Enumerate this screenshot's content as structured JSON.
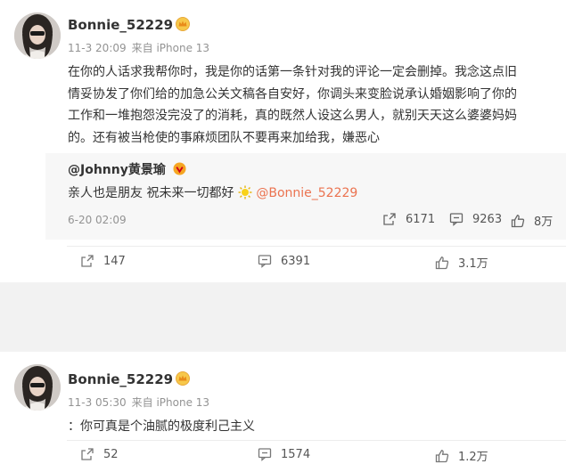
{
  "post1": {
    "username": "Bonnie_52229",
    "time": "11-3 20:09",
    "source": "来自 iPhone 13",
    "content_lines": [
      "在你的人话求我帮你时，我是你的话第一条针对我的评论一定会删掉。我念这点旧",
      "情妥协发了你们给的加急公关文稿各自安好，你调头来变脸说承认婚姻影响了你的",
      "工作和一堆抱怨没完没了的消耗，真的既然人设这么男人，就别天天这么婆婆妈妈",
      "的。还有被当枪使的事麻烦团队不要再来加给我，嫌恶心"
    ],
    "repost": {
      "user": "@Johnny黄景瑜",
      "text": "亲人也是朋友 祝未来一切都好",
      "mention": "@Bonnie_52229",
      "time": "6-20 02:09",
      "forward_count": "6171",
      "comment_count": "9263",
      "like_count": "8万"
    },
    "forward_count": "147",
    "comment_count": "6391",
    "like_count": "3.1万"
  },
  "post2": {
    "username": "Bonnie_52229",
    "time": "11-3 05:30",
    "source": "来自 iPhone 13",
    "content": "：你可真是个油腻的极度利己主义",
    "forward_count": "52",
    "comment_count": "1574",
    "like_count": "1.2万"
  },
  "icons": {
    "forward": "forward-icon",
    "comment": "comment-icon",
    "like": "like-icon",
    "vip_badge": "crown-badge-icon",
    "verified_badge": "verified-badge-icon",
    "emoji": "sun-emoji-icon"
  },
  "colors": {
    "mention": "#eb7350",
    "meta": "#939393",
    "divider": "#f2f2f2",
    "repost_bg": "#f7f7f7"
  }
}
